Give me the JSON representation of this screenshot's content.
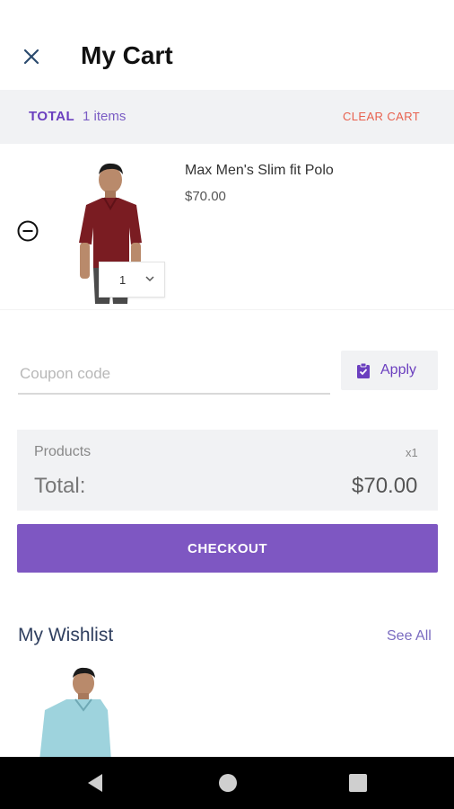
{
  "header": {
    "title": "My Cart",
    "close_icon": "close-icon"
  },
  "total_bar": {
    "label": "TOTAL",
    "count": "1 items",
    "clear_label": "CLEAR CART"
  },
  "cart_items": [
    {
      "name": "Max Men's Slim fit Polo",
      "price": "$70.00",
      "quantity": "1",
      "shirt_color": "#7a1c22"
    }
  ],
  "coupon": {
    "placeholder": "Coupon code",
    "value": "",
    "apply_label": "Apply"
  },
  "summary": {
    "products_label": "Products",
    "products_count": "x1",
    "total_label": "Total:",
    "total_amount": "$70.00"
  },
  "checkout": {
    "label": "CHECKOUT"
  },
  "wishlist": {
    "title": "My Wishlist",
    "see_all_label": "See All",
    "items": [
      {
        "shirt_color": "#9ed3dd"
      }
    ]
  },
  "colors": {
    "accent": "#7e57c2",
    "clear": "#e8614e",
    "panel": "#f1f2f4"
  }
}
